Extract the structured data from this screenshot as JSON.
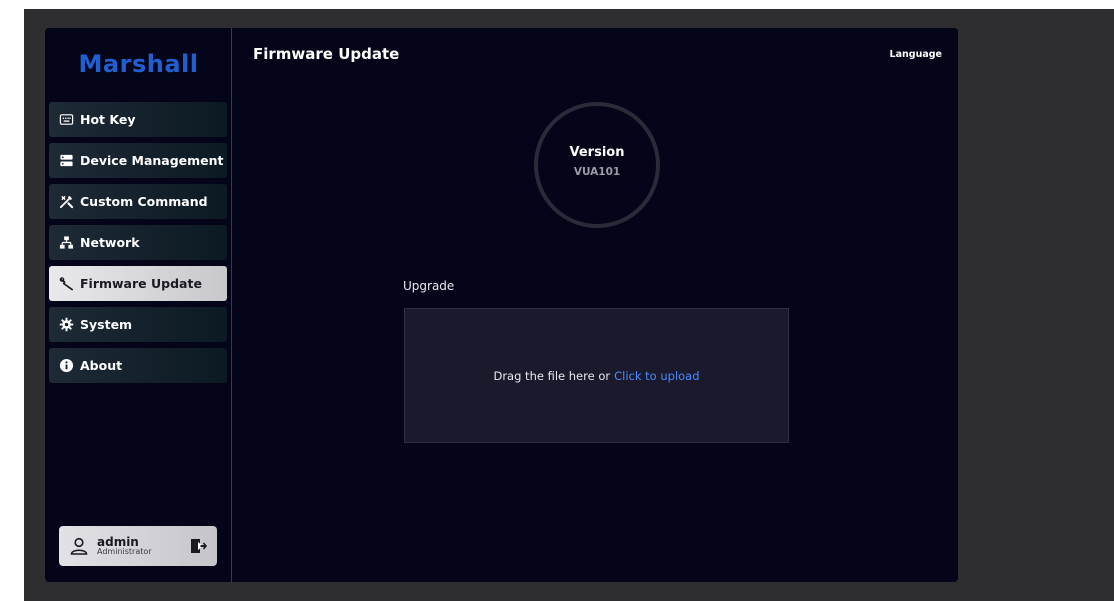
{
  "brand": {
    "logo_text": "Marshall",
    "logo_color": "#1f5fd0"
  },
  "sidebar": {
    "items": [
      {
        "label": "Hot Key",
        "icon": "keyboard-icon",
        "active": false
      },
      {
        "label": "Device Management",
        "icon": "server-icon",
        "active": false
      },
      {
        "label": "Custom Command",
        "icon": "tools-icon",
        "active": false
      },
      {
        "label": "Network",
        "icon": "network-icon",
        "active": false
      },
      {
        "label": "Firmware Update",
        "icon": "wrench-icon",
        "active": true
      },
      {
        "label": "System",
        "icon": "gear-icon",
        "active": false
      },
      {
        "label": "About",
        "icon": "info-icon",
        "active": false
      }
    ]
  },
  "user": {
    "name": "admin",
    "role": "Administrator"
  },
  "header": {
    "title": "Firmware Update",
    "language_label": "Language"
  },
  "version": {
    "label": "Version",
    "value": "VUA101"
  },
  "upgrade": {
    "label": "Upgrade",
    "drop_text": "Drag the file here or",
    "upload_link": "Click to upload",
    "link_color": "#4a8bff"
  },
  "colors": {
    "background": "#05051a",
    "active_nav": "#e9e9ec",
    "accent": "#4a8bff"
  }
}
